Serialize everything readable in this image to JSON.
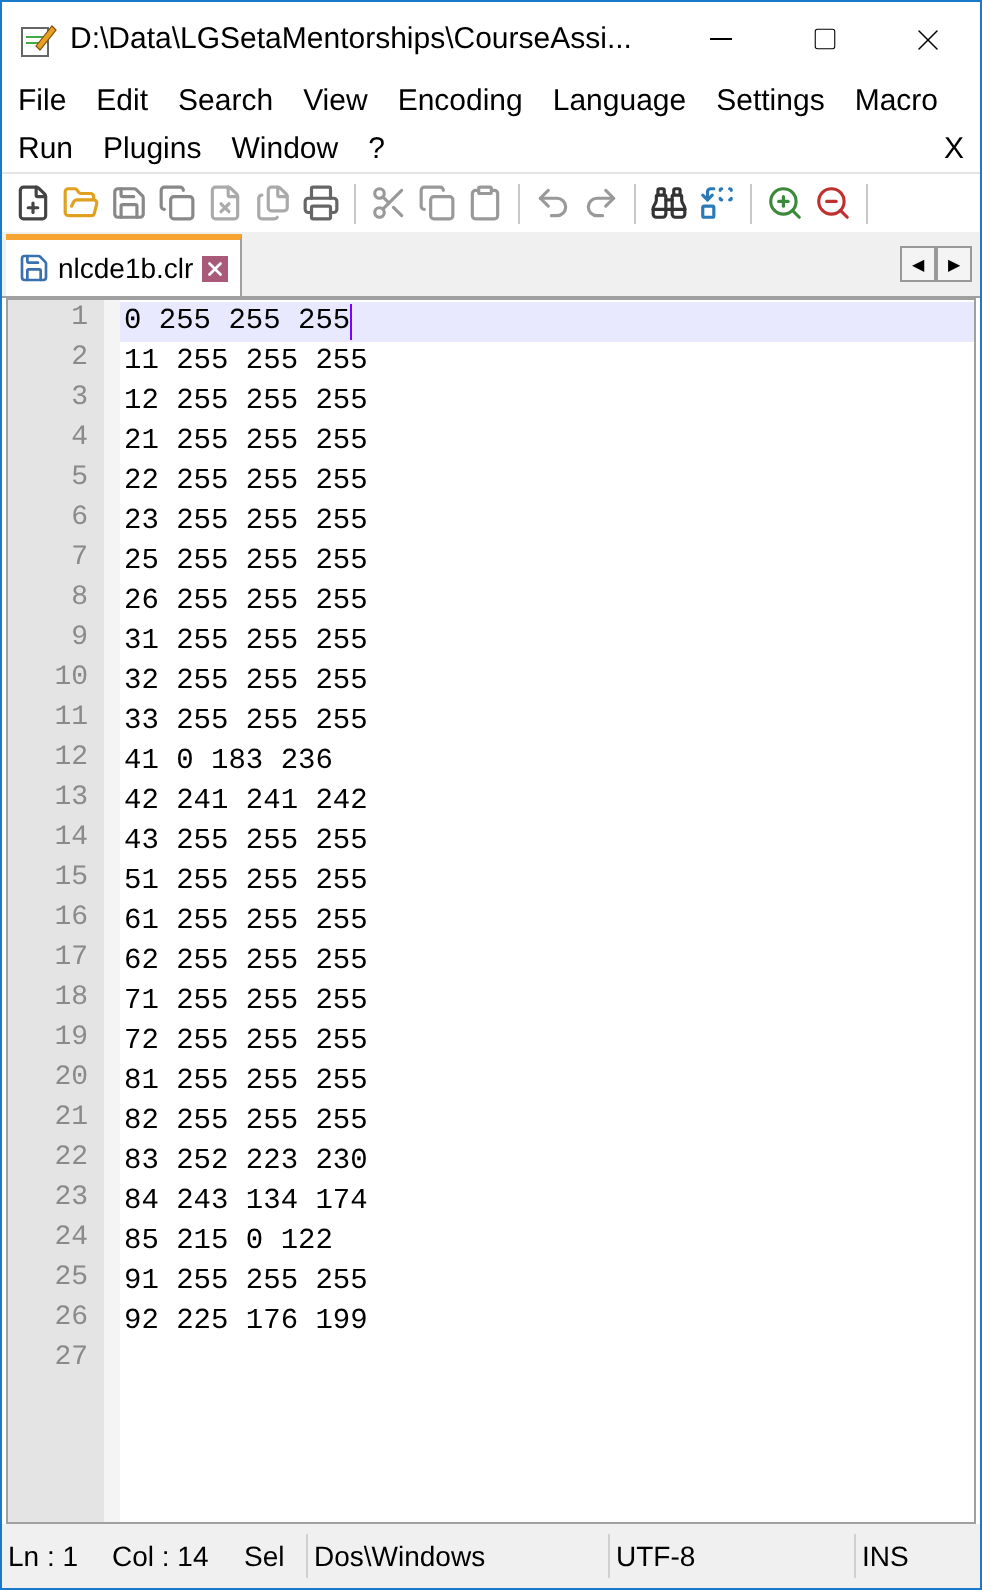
{
  "window": {
    "title": "D:\\Data\\LGSetaMentorships\\CourseAssi..."
  },
  "menu_rows": [
    [
      "File",
      "Edit",
      "Search",
      "View",
      "Encoding",
      "Language",
      "Settings",
      "Macro"
    ],
    [
      "Run",
      "Plugins",
      "Window",
      "?"
    ]
  ],
  "menu_close": "X",
  "tabs": [
    {
      "label": "nlcde1b.clr",
      "selected": true
    }
  ],
  "tab_scroll": [
    "◀",
    "▶"
  ],
  "lines": [
    {
      "number": "1",
      "text": "0 255 255 255",
      "selected": true
    },
    {
      "number": "2",
      "text": "11 255 255 255",
      "selected": false
    },
    {
      "number": "3",
      "text": "12 255 255 255",
      "selected": false
    },
    {
      "number": "4",
      "text": "21 255 255 255",
      "selected": false
    },
    {
      "number": "5",
      "text": "22 255 255 255",
      "selected": false
    },
    {
      "number": "6",
      "text": "23 255 255 255",
      "selected": false
    },
    {
      "number": "7",
      "text": "25 255 255 255",
      "selected": false
    },
    {
      "number": "8",
      "text": "26 255 255 255",
      "selected": false
    },
    {
      "number": "9",
      "text": "31 255 255 255",
      "selected": false
    },
    {
      "number": "10",
      "text": "32 255 255 255",
      "selected": false
    },
    {
      "number": "11",
      "text": "33 255 255 255",
      "selected": false
    },
    {
      "number": "12",
      "text": "41 0 183 236",
      "selected": false
    },
    {
      "number": "13",
      "text": "42 241 241 242",
      "selected": false
    },
    {
      "number": "14",
      "text": "43 255 255 255",
      "selected": false
    },
    {
      "number": "15",
      "text": "51 255 255 255",
      "selected": false
    },
    {
      "number": "16",
      "text": "61 255 255 255",
      "selected": false
    },
    {
      "number": "17",
      "text": "62 255 255 255",
      "selected": false
    },
    {
      "number": "18",
      "text": "71 255 255 255",
      "selected": false
    },
    {
      "number": "19",
      "text": "72 255 255 255",
      "selected": false
    },
    {
      "number": "20",
      "text": "81 255 255 255",
      "selected": false
    },
    {
      "number": "21",
      "text": "82 255 255 255",
      "selected": false
    },
    {
      "number": "22",
      "text": "83 252 223 230",
      "selected": false
    },
    {
      "number": "23",
      "text": "84 243 134 174",
      "selected": false
    },
    {
      "number": "24",
      "text": "85 215 0 122",
      "selected": false
    },
    {
      "number": "25",
      "text": "91 255 255 255",
      "selected": false
    },
    {
      "number": "26",
      "text": "92 225 176 199",
      "selected": false
    },
    {
      "number": "27",
      "selected": false
    }
  ],
  "status_bar": [
    "Ln : 1",
    "Col : 14",
    "Sel",
    "Dos\\Windows",
    "UTF-8",
    "INS"
  ]
}
